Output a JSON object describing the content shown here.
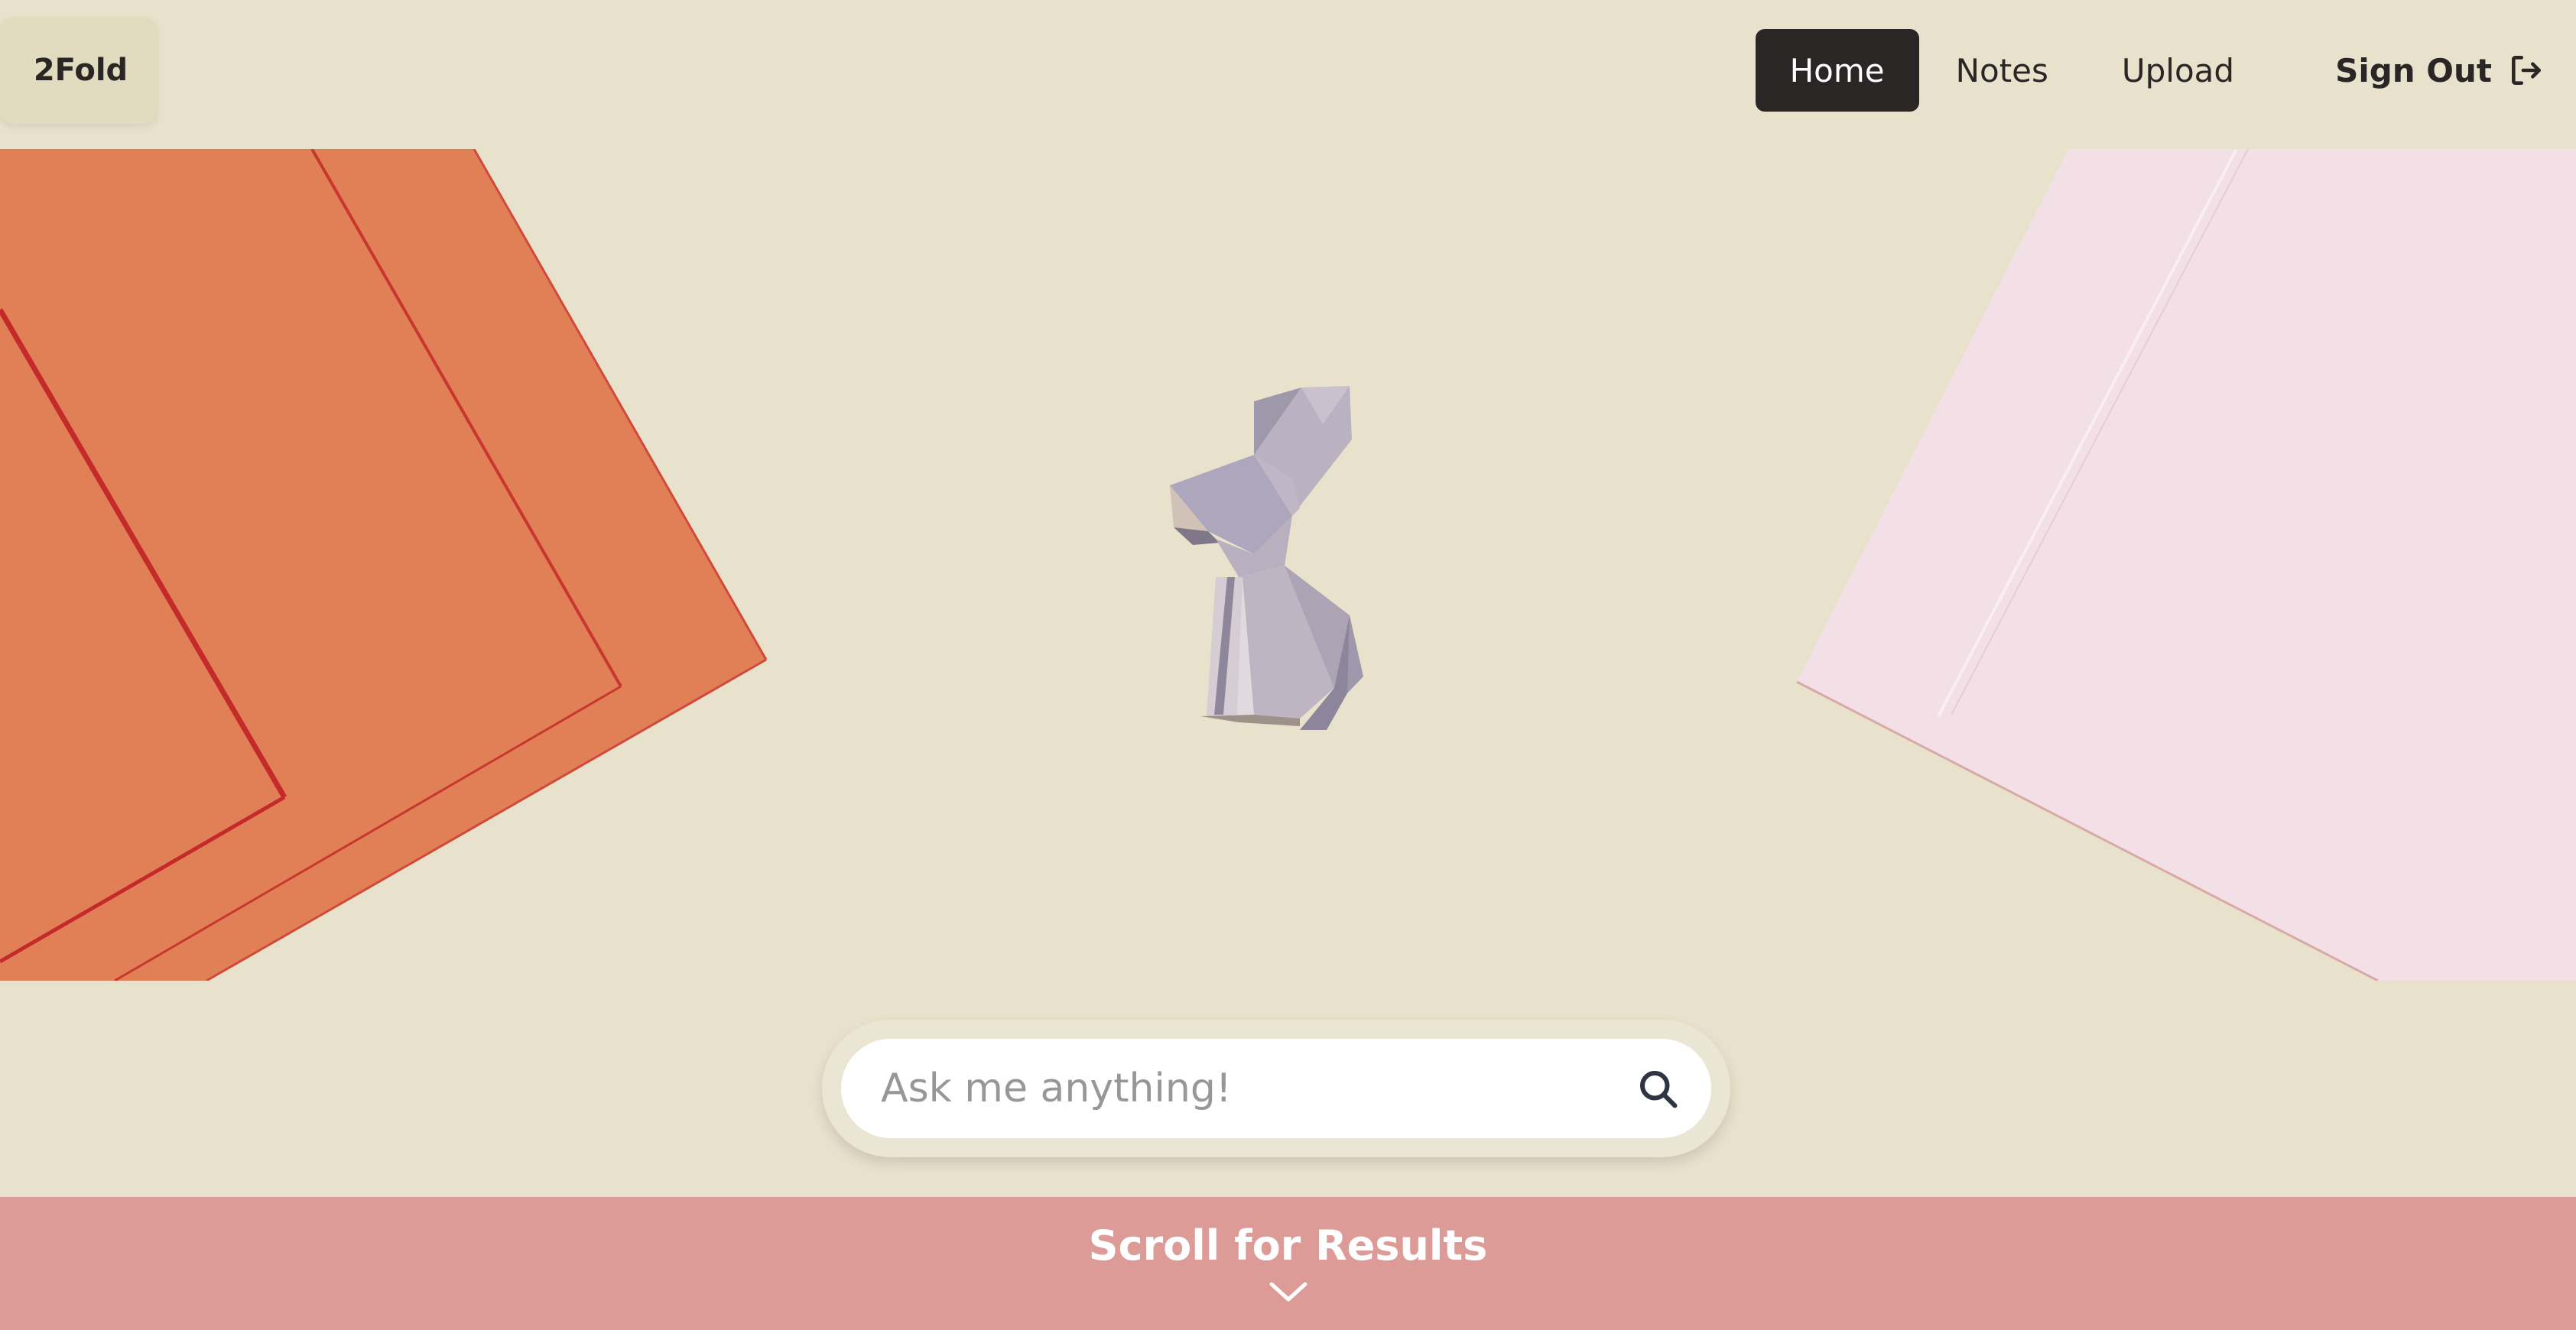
{
  "brand": {
    "logo_label": "2Fold"
  },
  "nav": {
    "items": [
      {
        "label": "Home",
        "active": true
      },
      {
        "label": "Notes",
        "active": false
      },
      {
        "label": "Upload",
        "active": false
      }
    ],
    "sign_out_label": "Sign Out",
    "sign_out_icon": "sign-out-icon"
  },
  "hero": {
    "illustration": "origami-rabbit",
    "left_paper_color": "#e17f56",
    "right_paper_color": "#f2e0e6"
  },
  "search": {
    "placeholder": "Ask me anything!",
    "value": "",
    "icon": "search-icon"
  },
  "results_bar": {
    "label": "Scroll for Results",
    "icon": "chevron-down-icon",
    "color": "#dc9b96"
  },
  "colors": {
    "background": "#e8e2cc",
    "nav_active_bg": "#2a2626",
    "text": "#2a2626"
  }
}
